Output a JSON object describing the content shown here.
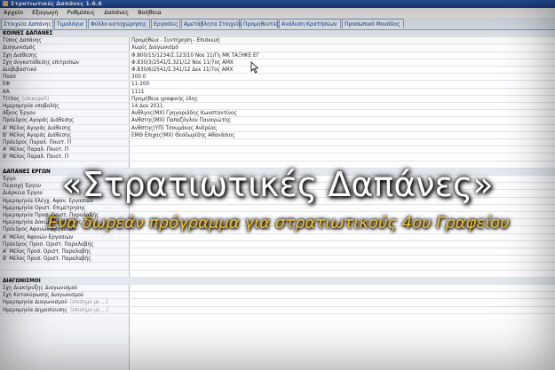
{
  "window": {
    "title": "Στρατιωτικές Δαπάνες 1.6.6"
  },
  "menu": [
    "Αρχείο",
    "Εξαγωγή",
    "Ρυθμίσεις",
    "Δαπάνες",
    "Βοήθεια"
  ],
  "tabs": [
    "Στοιχεία Δαπάνης",
    "Τιμολόγια",
    "Φύλλο καταχώρησης",
    "Εργασίες",
    "Αμετάβλητα Στοιχεία",
    "Προμηθευτές",
    "Ανάλυση Κρατήσεων",
    "Προσωπικό Μονάδος"
  ],
  "rows": [
    {
      "label": "ΚΟΙΝΕΣ ΔΑΠΑΝΕΣ",
      "value": "",
      "section": true
    },
    {
      "label": "Τύπος Δαπάνης",
      "value": "Προμήθεια - Συντήρηση - Επισκευή"
    },
    {
      "label": "Διαγωνισμός",
      "value": "Χωρίς Διαγωνισμό"
    },
    {
      "label": "Σχη Διάθεσης",
      "value": "Φ.800/15/1234/Σ.123/10 Νοε 11/Γη ΜΚ ΤΑΞΗΚΕ ΕΓ"
    },
    {
      "label": "Σχη συγκατάθεσης επιτροπών",
      "value": "Φ.830/3/2541/Σ.321/12 Νοε 11/7ος ΑΜΧ"
    },
    {
      "label": "Διαβιβαστικό",
      "value": "Φ.830/6/2541/Σ.341/12 Δεκ 11/7ος ΑΜΧ"
    },
    {
      "label": "Ποσό",
      "value": "300.0"
    },
    {
      "label": "ΕΦ",
      "value": "11-200"
    },
    {
      "label": "ΚΑ",
      "value": "1111"
    },
    {
      "label": "Τίτλος",
      "hint": "(επικεφαλ)",
      "value": "Προμήθεια γραφικής ύλης"
    },
    {
      "label": "Ημερομηνία υποβολής",
      "value": "14 Δεκ 2011"
    },
    {
      "label": "Αξκος Έργου",
      "value": "Ανθλγος(ΜΧ) Γρηγοριάδης Κωνσταντίνος"
    },
    {
      "label": "Πρόεδρος Αγοράς Διάθεσης",
      "value": "Ανθστης(ΜΧ) Παπαζόγλου Παναγιώτης"
    },
    {
      "label": "Α' Μέλος Αγοράς Διάθεσης",
      "value": "Ανθστης(ΥΠ) Τσουμάκας Ανδρέας"
    },
    {
      "label": "Β' Μέλος Αγοράς Διάθεσης",
      "value": "ΕΜΘ Επιχας(ΜΧ) Θεοδωρίδης Αθανάσιος"
    },
    {
      "label": "Πρόεδρος Παραλ. Ποιοτ. Π",
      "value": ""
    },
    {
      "label": "Α' Μέλος Παραλ. Ποιοτ. Π",
      "value": ""
    },
    {
      "label": "Β' Μέλος Παραλ. Ποιοτ. Π",
      "value": ""
    },
    {
      "label": "",
      "value": ""
    },
    {
      "label": "ΔΑΠΑΝΕΣ ΕΡΓΩΝ",
      "value": "",
      "section": true
    },
    {
      "label": "Έργο",
      "value": ""
    },
    {
      "label": "Περιοχή Έργου",
      "value": ""
    },
    {
      "label": "Διάρκεια Έργου",
      "value": ""
    },
    {
      "label": "Ημερομηνία Ελέγχ. Αφαν. Εργασιών",
      "value": ""
    },
    {
      "label": "Ημερομηνία Οριστ. Επιμέτρησης",
      "value": ""
    },
    {
      "label": "Ημερομηνία Προσ. Οριστ. Παραλαβής",
      "value": ""
    },
    {
      "label": "Ημερομηνία Δοκιμ. Παράδοσης",
      "value": ""
    },
    {
      "label": "Πρόεδρος Αφανών Εργασιών",
      "value": ""
    },
    {
      "label": "Α' Μέλος Αφανών Εργασιών",
      "value": ""
    },
    {
      "label": "Πρόεδρος Προσ. Οριστ. Παραλαβής",
      "value": ""
    },
    {
      "label": "Α' Μέλος Προσ. Οριστ. Παραλαβής",
      "value": ""
    },
    {
      "label": "Β' Μέλος Προσ. Οριστ. Παραλαβής",
      "value": ""
    },
    {
      "label": "",
      "value": ""
    },
    {
      "label": "",
      "value": ""
    },
    {
      "label": "ΔΙΑΓΩΝΙΣΜΟΙ",
      "value": "",
      "section": true
    },
    {
      "label": "Σχη Διακήρυξης Διαγωνισμού",
      "value": ""
    },
    {
      "label": "Σχη Κατακύρωσης Διαγωνισμού",
      "value": ""
    },
    {
      "label": "Ημερομηνία Διαγωνισμού",
      "hint": "(επισημο με ...)",
      "value": ""
    },
    {
      "label": "Ημερομηνία Δημοσίευσης",
      "hint": "(επισημο με ...)",
      "value": ""
    }
  ],
  "overlay": {
    "title": "«Στρατιωτικές Δαπάνες»",
    "subtitle": "Ένα δωρεάν πρόγραμμα για στρατιωτικούς 4ου Γραφείου"
  }
}
